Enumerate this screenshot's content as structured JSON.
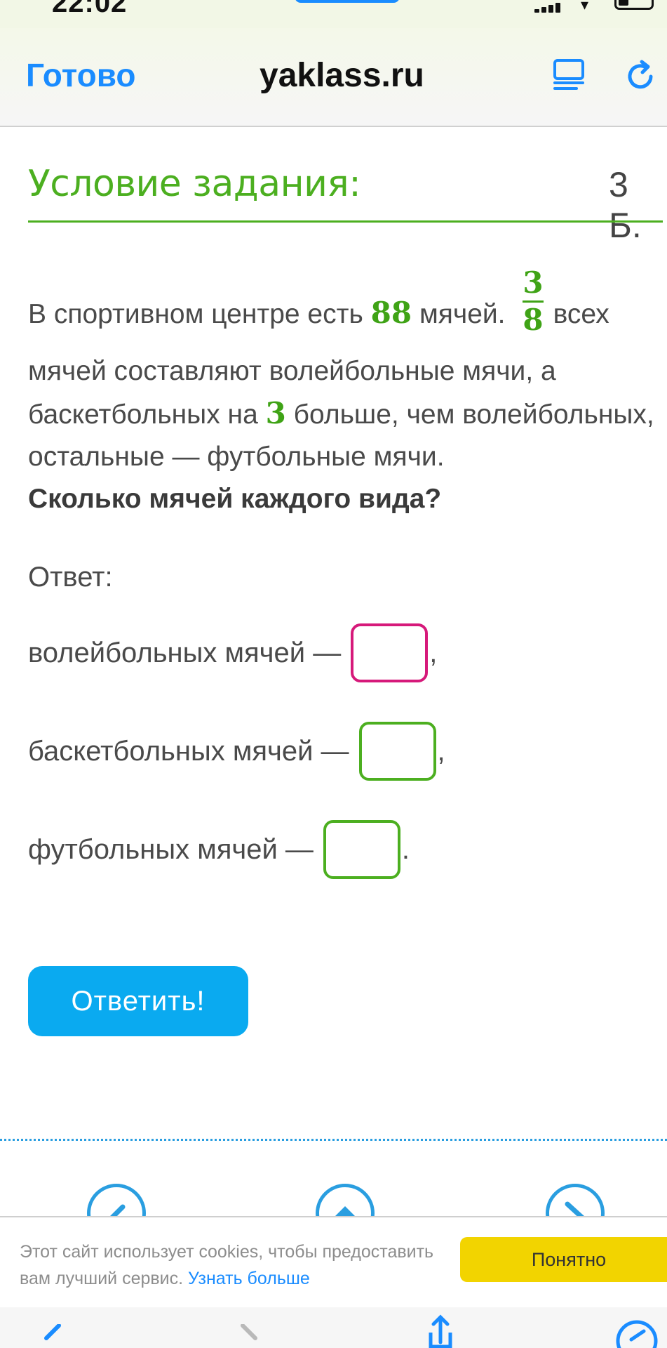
{
  "status_bar": {
    "time": "22:02"
  },
  "browser": {
    "done_label": "Готово",
    "site": "yaklass.ru"
  },
  "task": {
    "heading": "Условие задания:",
    "points": "3 Б.",
    "text_part1": "В спортивном центре есть ",
    "total_balls": "88",
    "text_part2": " мячей. ",
    "fraction_numerator": "3",
    "fraction_denominator": "8",
    "text_part3": "всех мячей составляют волейбольные мячи, а баскетбольных на ",
    "difference": "3",
    "text_part4": " больше, чем волейбольных, остальные — футбольные мячи.",
    "question": "Сколько мячей каждого вида?"
  },
  "answer": {
    "label": "Ответ:",
    "rows": [
      {
        "label": "волейбольных мячей —",
        "value": "",
        "punct": ","
      },
      {
        "label": "баскетбольных мячей —",
        "value": "",
        "punct": ","
      },
      {
        "label": "футбольных мячей —",
        "value": "",
        "punct": "."
      }
    ],
    "submit_label": "Ответить!"
  },
  "cookie_banner": {
    "text": "Этот сайт использует cookies, чтобы предоставить вам лучший сервис. ",
    "link": "Узнать больше",
    "button": "Понятно"
  },
  "colors": {
    "accent_green": "#4caf20",
    "focus_pink": "#d6197a",
    "button_blue": "#0aaaf0",
    "link_blue": "#1a8cff",
    "cookie_yellow": "#f2d400"
  },
  "icons": [
    "reader-view-icon",
    "reload-icon",
    "back-icon",
    "forward-icon",
    "share-icon",
    "compass-icon"
  ]
}
